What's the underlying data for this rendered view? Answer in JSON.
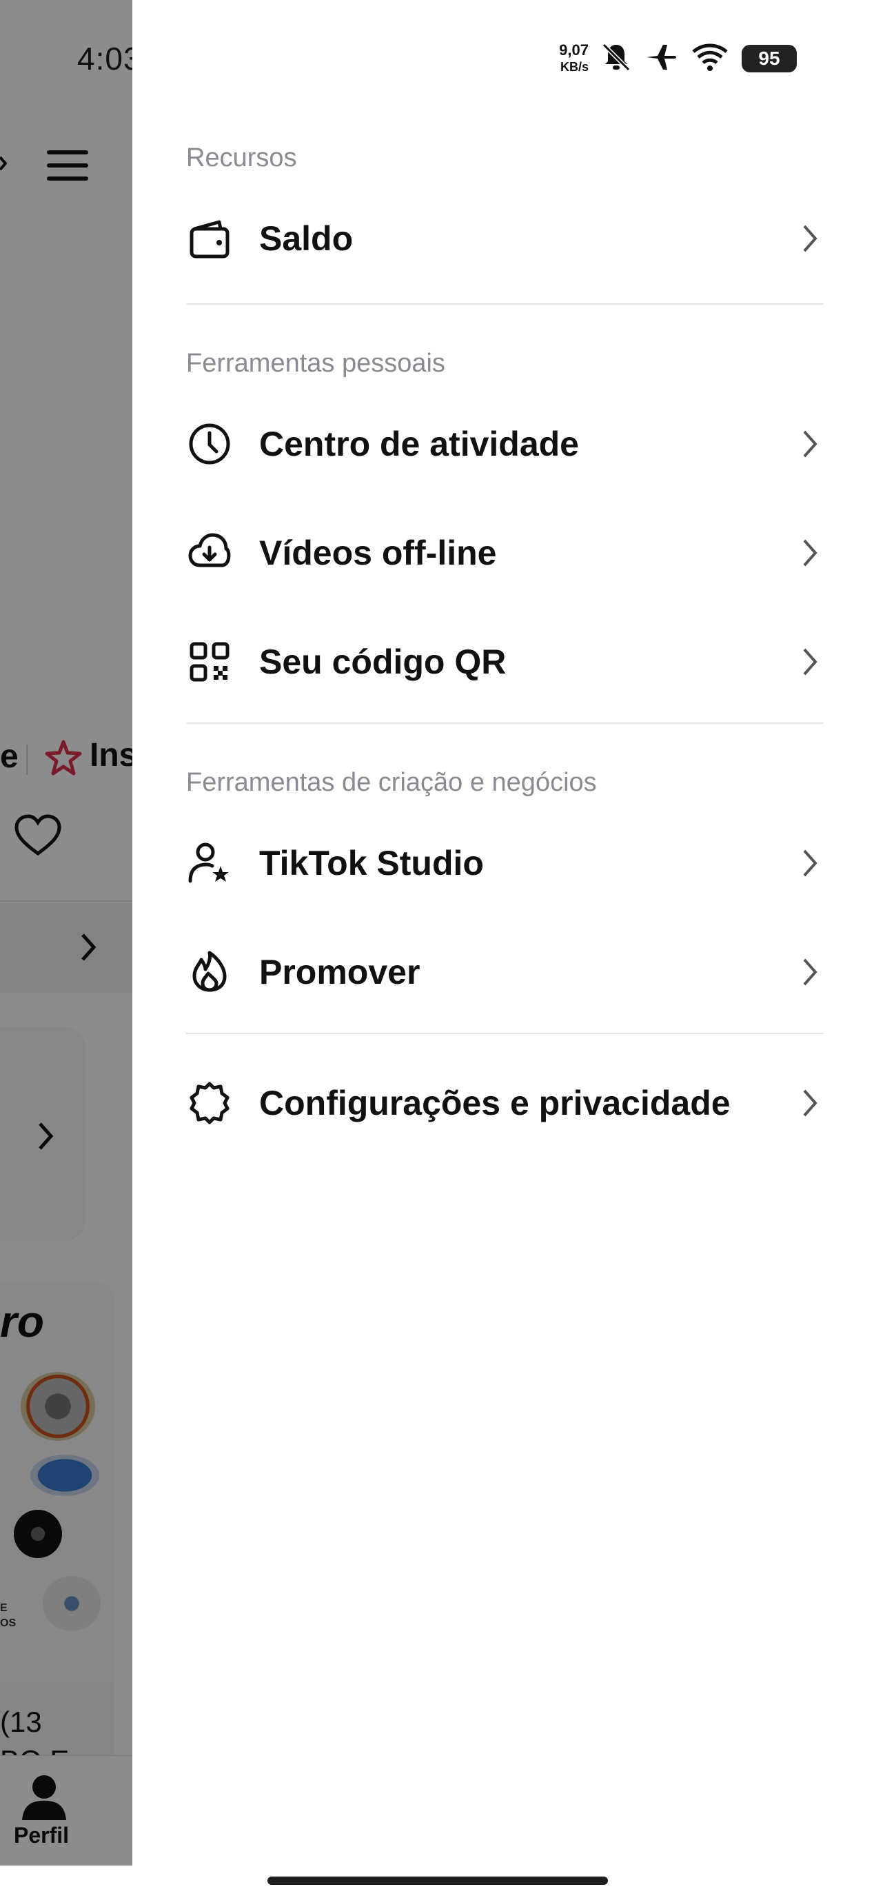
{
  "status_bar": {
    "time": "4:03",
    "net_speed_value": "9,07",
    "net_speed_unit": "KB/s",
    "battery": "95"
  },
  "background": {
    "partial_tab_label": "Ins",
    "partial_left_text": "e",
    "heading_partial": "ro",
    "text_partial_1": "(13",
    "text_partial_2": "BO E",
    "small_text_1": "E",
    "small_text_2": "OS",
    "nav_profile_label": "Perfil"
  },
  "drawer": {
    "sections": {
      "recursos": "Recursos",
      "ferramentas_pessoais": "Ferramentas pessoais",
      "ferramentas_criacao": "Ferramentas de criação e negócios"
    },
    "items": {
      "saldo": "Saldo",
      "centro_atividade": "Centro de atividade",
      "videos_offline": "Vídeos off-line",
      "codigo_qr": "Seu código QR",
      "tiktok_studio": "TikTok Studio",
      "promover": "Promover",
      "configuracoes": "Configurações e privacidade"
    },
    "icons": [
      "wallet-icon",
      "clock-icon",
      "cloud-download-icon",
      "qr-code-icon",
      "user-star-icon",
      "flame-icon",
      "gear-icon",
      "chevron-right-icon"
    ]
  },
  "colors": {
    "section_title": "#8a8b91",
    "item_text": "#111111",
    "divider": "#e6e6e6",
    "overlay": "rgba(0,0,0,0.45)",
    "accent_red": "#e0314f"
  }
}
